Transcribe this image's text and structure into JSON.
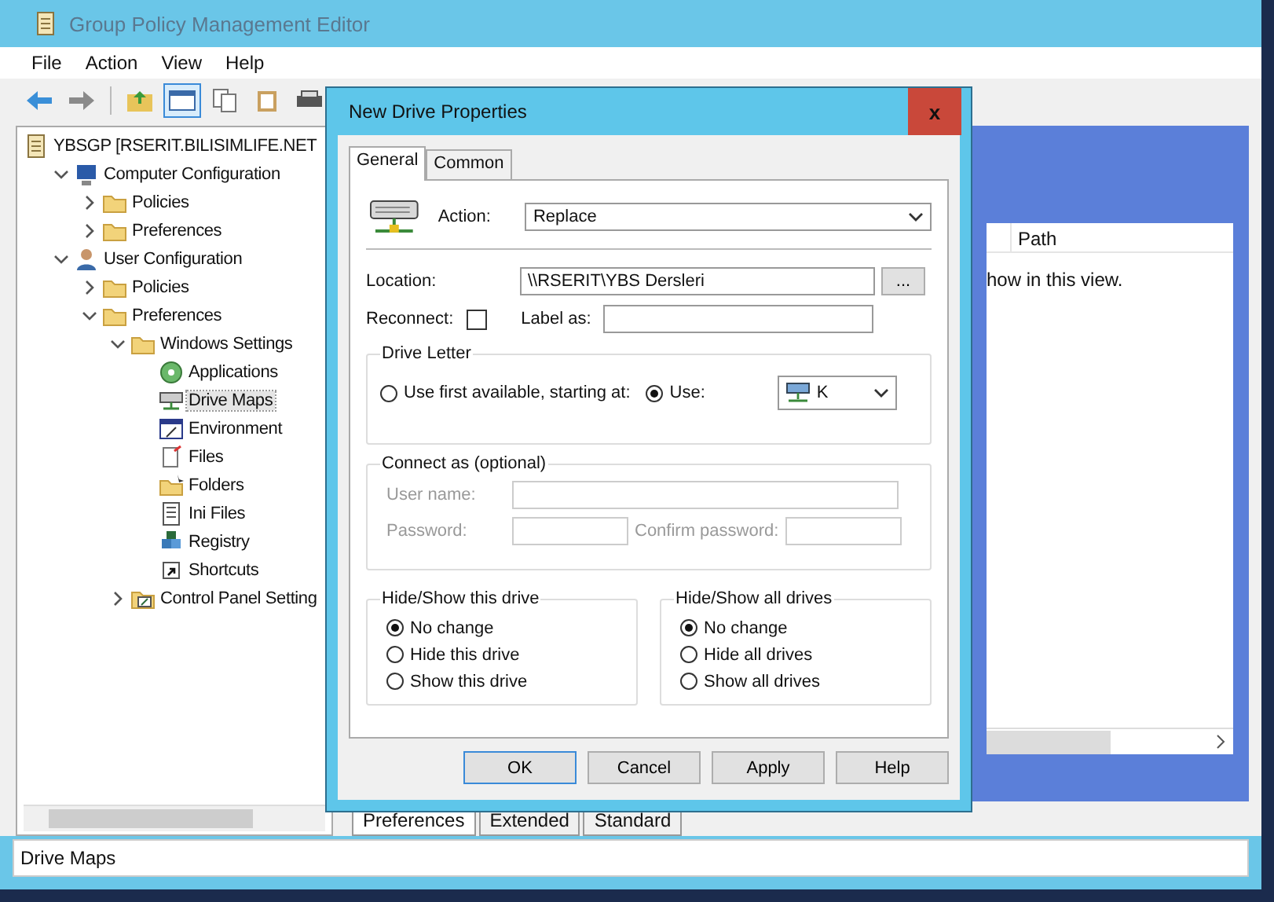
{
  "window": {
    "title": "Group Policy Management Editor"
  },
  "menu": [
    "File",
    "Action",
    "View",
    "Help"
  ],
  "tree": [
    {
      "label": "YBSGP [RSERIT.BILISIMLIFE.NET",
      "kind": "policy",
      "selected": false,
      "children": [
        {
          "label": "Computer Configuration",
          "kind": "computer",
          "expanded": true,
          "selected": false,
          "children": [
            {
              "label": "Policies",
              "kind": "folder",
              "expanded": false,
              "selected": false
            },
            {
              "label": "Preferences",
              "kind": "folder",
              "expanded": false,
              "selected": false
            }
          ]
        },
        {
          "label": "User Configuration",
          "kind": "user",
          "expanded": true,
          "selected": false,
          "children": [
            {
              "label": "Policies",
              "kind": "folder",
              "expanded": false,
              "selected": false
            },
            {
              "label": "Preferences",
              "kind": "folder",
              "expanded": true,
              "selected": false,
              "children": [
                {
                  "label": "Windows Settings",
                  "kind": "folder",
                  "expanded": true,
                  "selected": false,
                  "children": [
                    {
                      "label": "Applications",
                      "kind": "app",
                      "selected": false
                    },
                    {
                      "label": "Drive Maps",
                      "kind": "drive",
                      "selected": true
                    },
                    {
                      "label": "Environment",
                      "kind": "env",
                      "selected": false
                    },
                    {
                      "label": "Files",
                      "kind": "files",
                      "selected": false
                    },
                    {
                      "label": "Folders",
                      "kind": "folders",
                      "selected": false
                    },
                    {
                      "label": "Ini Files",
                      "kind": "ini",
                      "selected": false
                    },
                    {
                      "label": "Registry",
                      "kind": "registry",
                      "selected": false
                    },
                    {
                      "label": "Shortcuts",
                      "kind": "shortcut",
                      "selected": false
                    }
                  ]
                },
                {
                  "label": "Control Panel Setting",
                  "kind": "control",
                  "expanded": false,
                  "selected": false
                }
              ]
            }
          ]
        }
      ]
    }
  ],
  "list": {
    "columns": [
      "Path"
    ],
    "message": "how in this view."
  },
  "bottom_tabs": [
    {
      "label": "Preferences",
      "selected": true
    },
    {
      "label": "Extended",
      "selected": false
    },
    {
      "label": "Standard",
      "selected": false
    }
  ],
  "status_bar": "Drive Maps",
  "dialog": {
    "title": "New Drive Properties",
    "close": "x",
    "tabs": [
      {
        "label": "General",
        "selected": true
      },
      {
        "label": "Common",
        "selected": false
      }
    ],
    "action": {
      "label": "Action:",
      "value": "Replace"
    },
    "location": {
      "label": "Location:",
      "value": "\\\\RSERIT\\YBS Dersleri",
      "browse": "..."
    },
    "reconnect": {
      "label": "Reconnect:",
      "checked": false
    },
    "label_as": {
      "label": "Label as:"
    },
    "drive_letter": {
      "title": "Drive Letter",
      "options": [
        {
          "label": "Use first available, starting at:",
          "selected": false
        },
        {
          "label": "Use:",
          "selected": true
        }
      ],
      "drive": "K"
    },
    "connect_as": {
      "title": "Connect as (optional)",
      "disabled": true,
      "user_name": "User name:",
      "password": "Password:",
      "confirm": "Confirm password:"
    },
    "groups": [
      {
        "title": "Hide/Show this drive",
        "options": [
          {
            "label": "No change",
            "selected": true
          },
          {
            "label": "Hide this drive",
            "selected": false
          },
          {
            "label": "Show this drive",
            "selected": false
          }
        ]
      },
      {
        "title": "Hide/Show all drives",
        "options": [
          {
            "label": "No change",
            "selected": true
          },
          {
            "label": "Hide all drives",
            "selected": false
          },
          {
            "label": "Show all drives",
            "selected": false
          }
        ]
      }
    ],
    "buttons": [
      "OK",
      "Cancel",
      "Apply",
      "Help"
    ]
  }
}
